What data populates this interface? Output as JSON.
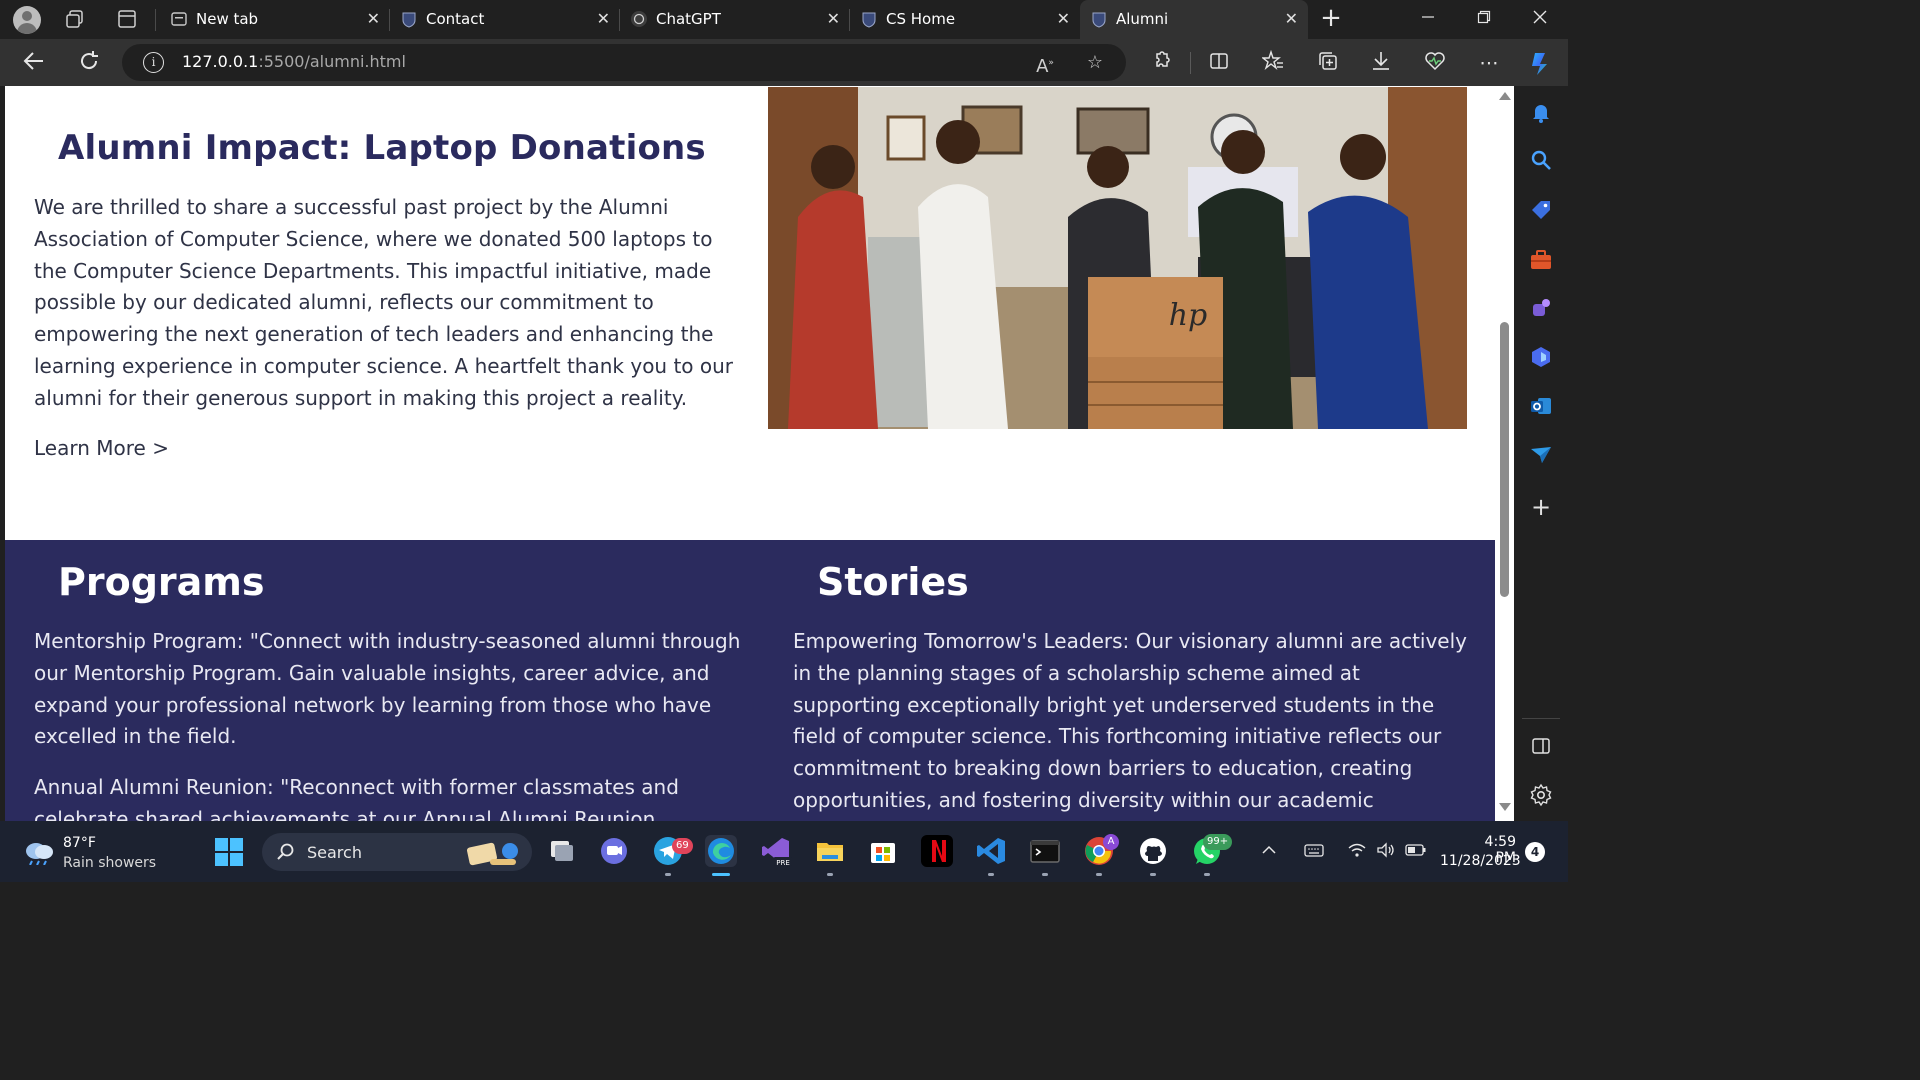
{
  "browser": {
    "tabs": [
      {
        "label": "New tab",
        "favicon": "new-tab-icon"
      },
      {
        "label": "Contact",
        "favicon": "university-crest-icon"
      },
      {
        "label": "ChatGPT",
        "favicon": "chatgpt-icon"
      },
      {
        "label": "CS Home",
        "favicon": "university-crest-icon"
      },
      {
        "label": "Alumni",
        "favicon": "university-crest-icon",
        "active": true
      }
    ],
    "new_tab": "+",
    "close_glyph": "✕",
    "address": {
      "host": "127.0.0.1",
      "path": ":5500/alumni.html"
    }
  },
  "page": {
    "impact": {
      "title": "Alumni Impact: Laptop Donations",
      "text": "We are thrilled to share a successful past project by the Alumni Association of Computer Science, where we donated 500 laptops to the Computer Science Departments. This impactful initiative, made possible by our dedicated alumni, reflects our commitment to empowering the next generation of tech leaders and enhancing the learning experience in computer science. A heartfelt thank you to our alumni for their generous support in making this project a reality.",
      "link": "Learn More >",
      "photo_text": "hp"
    },
    "programs": {
      "title": "Programs",
      "item1": "Mentorship Program: \"Connect with industry-seasoned alumni through our Mentorship Program. Gain valuable insights, career advice, and expand your professional network by learning from those who have excelled in the field.",
      "item2": "Annual Alumni Reunion: \"Reconnect with former classmates and celebrate shared achievements at our Annual Alumni Reunion."
    },
    "stories": {
      "title": "Stories",
      "item1": "Empowering Tomorrow's Leaders: Our visionary alumni are actively in the planning stages of a scholarship scheme aimed at supporting exceptionally bright yet underserved students in the field of computer science. This forthcoming initiative reflects our commitment to breaking down barriers to education, creating opportunities, and fostering diversity within our academic"
    }
  },
  "taskbar": {
    "weather": {
      "temp": "87°F",
      "desc": "Rain showers"
    },
    "search_label": "Search",
    "telegram_badge": "69",
    "whatsapp_badge": "99+",
    "chrome_badge": "A",
    "clock": {
      "time": "4:59 PM",
      "date": "11/28/2023"
    },
    "notifications": "4"
  },
  "colors": {
    "brand_navy": "#2b2b5e",
    "title_navy": "#2a2a5e",
    "accent_blue": "#4cc2ff"
  }
}
